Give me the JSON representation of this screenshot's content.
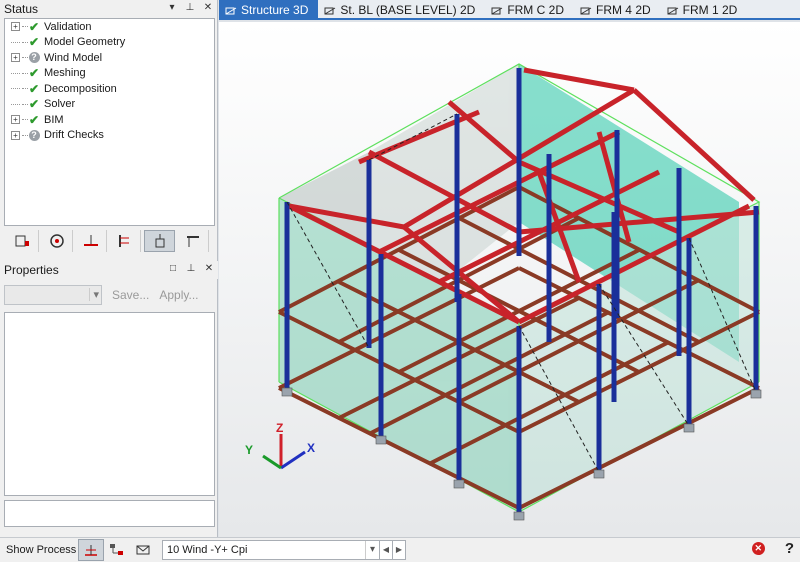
{
  "status_panel": {
    "title": "Status",
    "items": [
      {
        "label": "Validation",
        "state": "check",
        "expandable": true
      },
      {
        "label": "Model Geometry",
        "state": "check",
        "expandable": false
      },
      {
        "label": "Wind Model",
        "state": "question",
        "expandable": true
      },
      {
        "label": "Meshing",
        "state": "check",
        "expandable": false
      },
      {
        "label": "Decomposition",
        "state": "check",
        "expandable": false
      },
      {
        "label": "Solver",
        "state": "check",
        "expandable": false
      },
      {
        "label": "BIM",
        "state": "check",
        "expandable": true
      },
      {
        "label": "Drift Checks",
        "state": "question",
        "expandable": true
      }
    ],
    "controls": [
      "dropdown-icon",
      "pin-icon",
      "close-icon"
    ]
  },
  "toolstrip": {
    "buttons": [
      "frame-icon",
      "globe-icon",
      "support-icon",
      "elevation-icon",
      "load-icon",
      "beam-icon"
    ],
    "active_index": 4
  },
  "properties_panel": {
    "title": "Properties",
    "save_label": "Save...",
    "apply_label": "Apply...",
    "combo_value": ""
  },
  "tabs": [
    {
      "label": "Structure 3D",
      "active": true,
      "icon": "cube-icon"
    },
    {
      "label": "St. BL (BASE LEVEL) 2D",
      "active": false,
      "icon": "plan-icon"
    },
    {
      "label": "FRM C 2D",
      "active": false,
      "icon": "frame-2d-icon"
    },
    {
      "label": "FRM 4 2D",
      "active": false,
      "icon": "frame-2d-icon"
    },
    {
      "label": "FRM 1 2D",
      "active": false,
      "icon": "frame-2d-icon"
    }
  ],
  "axes": {
    "z": "Z",
    "y": "Y",
    "x": "X"
  },
  "colors": {
    "accent": "#2f6fbf",
    "beam_red": "#c8232a",
    "beam_brown": "#8a3a25",
    "column_blue": "#1a2f9a",
    "panel_green": "#27c7a6",
    "outline_green": "#5ee05e"
  },
  "statusbar": {
    "show_process_label": "Show Process",
    "load_case": "10 Wind -Y+ Cpi",
    "buttons": [
      "process-icon",
      "tree-icon",
      "mail-icon"
    ]
  }
}
